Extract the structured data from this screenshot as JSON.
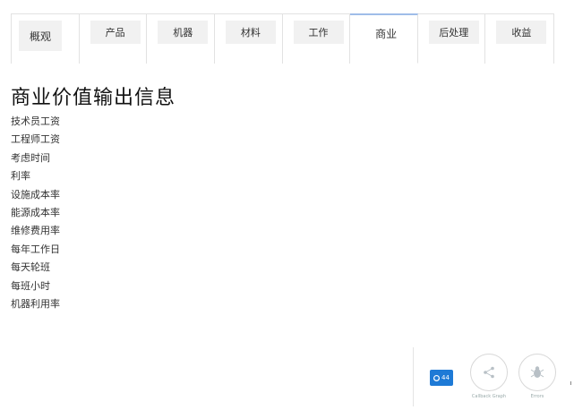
{
  "tabs": [
    {
      "label": "概观",
      "active": false
    },
    {
      "label": "产品",
      "active": false
    },
    {
      "label": "机器",
      "active": false
    },
    {
      "label": "材料",
      "active": false
    },
    {
      "label": "工作",
      "active": false
    },
    {
      "label": "商业",
      "active": true
    },
    {
      "label": "后处理",
      "active": false
    },
    {
      "label": "收益",
      "active": false
    }
  ],
  "main": {
    "title": "商业价值输出信息",
    "fields": [
      "技术员工资",
      "工程师工资",
      "考虑时间",
      "利率",
      "设施成本率",
      "能源成本率",
      "维修费用率",
      "每年工作日",
      "每天轮班",
      "每班小时",
      "机器利用率"
    ]
  },
  "debug_menu": {
    "badge_count": "44",
    "badge_color": "#1e7ad6",
    "callback_graph_label": "Callback Graph",
    "errors_label": "Errors",
    "callback_icon": "share-graph-icon",
    "errors_icon": "bug-icon"
  },
  "colors": {
    "active_tab_accent": "#9fbde8",
    "tab_inner_bg": "#f1f1f1",
    "border": "#e2e2e2"
  }
}
